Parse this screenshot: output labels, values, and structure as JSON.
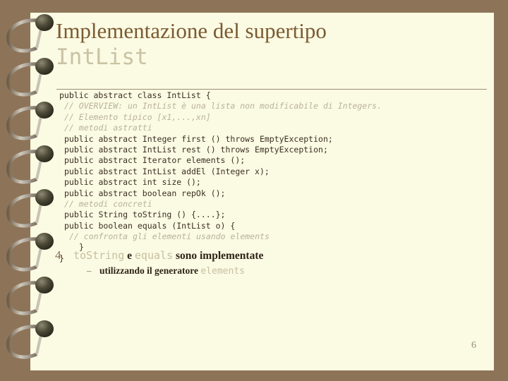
{
  "theme": {
    "background_color": "#8d7459",
    "page_color": "#fbfae3",
    "title_color": "#7a5a32",
    "title_mono_color": "#c9c3a4",
    "code_color": "#3b2f22",
    "comment_color": "#b9b39a",
    "rule_color": "#9b8e74"
  },
  "title": {
    "line1": "Implementazione del supertipo",
    "line2": "IntList"
  },
  "code": {
    "lines": [
      {
        "indent": 0,
        "comment": false,
        "text": "public abstract class IntList {"
      },
      {
        "indent": 1,
        "comment": true,
        "text": "// OVERVIEW: un IntList è una lista non modificabile di Integers."
      },
      {
        "indent": 1,
        "comment": true,
        "text": "// Elemento tipico [x1,...,xn]"
      },
      {
        "indent": 1,
        "comment": true,
        "text": "// metodi astratti"
      },
      {
        "indent": 1,
        "comment": false,
        "text": "public abstract Integer first () throws EmptyException;"
      },
      {
        "indent": 1,
        "comment": false,
        "text": "public abstract IntList rest () throws EmptyException;"
      },
      {
        "indent": 1,
        "comment": false,
        "text": "public abstract Iterator elements ();"
      },
      {
        "indent": 1,
        "comment": false,
        "text": "public abstract IntList addEl (Integer x);"
      },
      {
        "indent": 1,
        "comment": false,
        "text": "public abstract int size ();"
      },
      {
        "indent": 1,
        "comment": false,
        "text": "public abstract boolean repOk ();"
      },
      {
        "indent": 1,
        "comment": true,
        "text": "// metodi concreti"
      },
      {
        "indent": 1,
        "comment": false,
        "text": "public String toString () {....};"
      },
      {
        "indent": 1,
        "comment": false,
        "text": "public boolean equals (IntList o) {"
      },
      {
        "indent": 2,
        "comment": true,
        "text": "// confronta gli elementi usando elements"
      },
      {
        "indent": 3,
        "comment": false,
        "text": "}"
      },
      {
        "indent": 0,
        "comment": false,
        "text": "}"
      }
    ]
  },
  "bullets": {
    "level1": {
      "marker": "4",
      "part1": "toString",
      "part2": " e ",
      "part3": "equals",
      "part4": " sono implementate"
    },
    "level2": {
      "marker": "–",
      "part1": "utilizzando il generatore ",
      "part2": "elements"
    }
  },
  "slide_number": "6"
}
